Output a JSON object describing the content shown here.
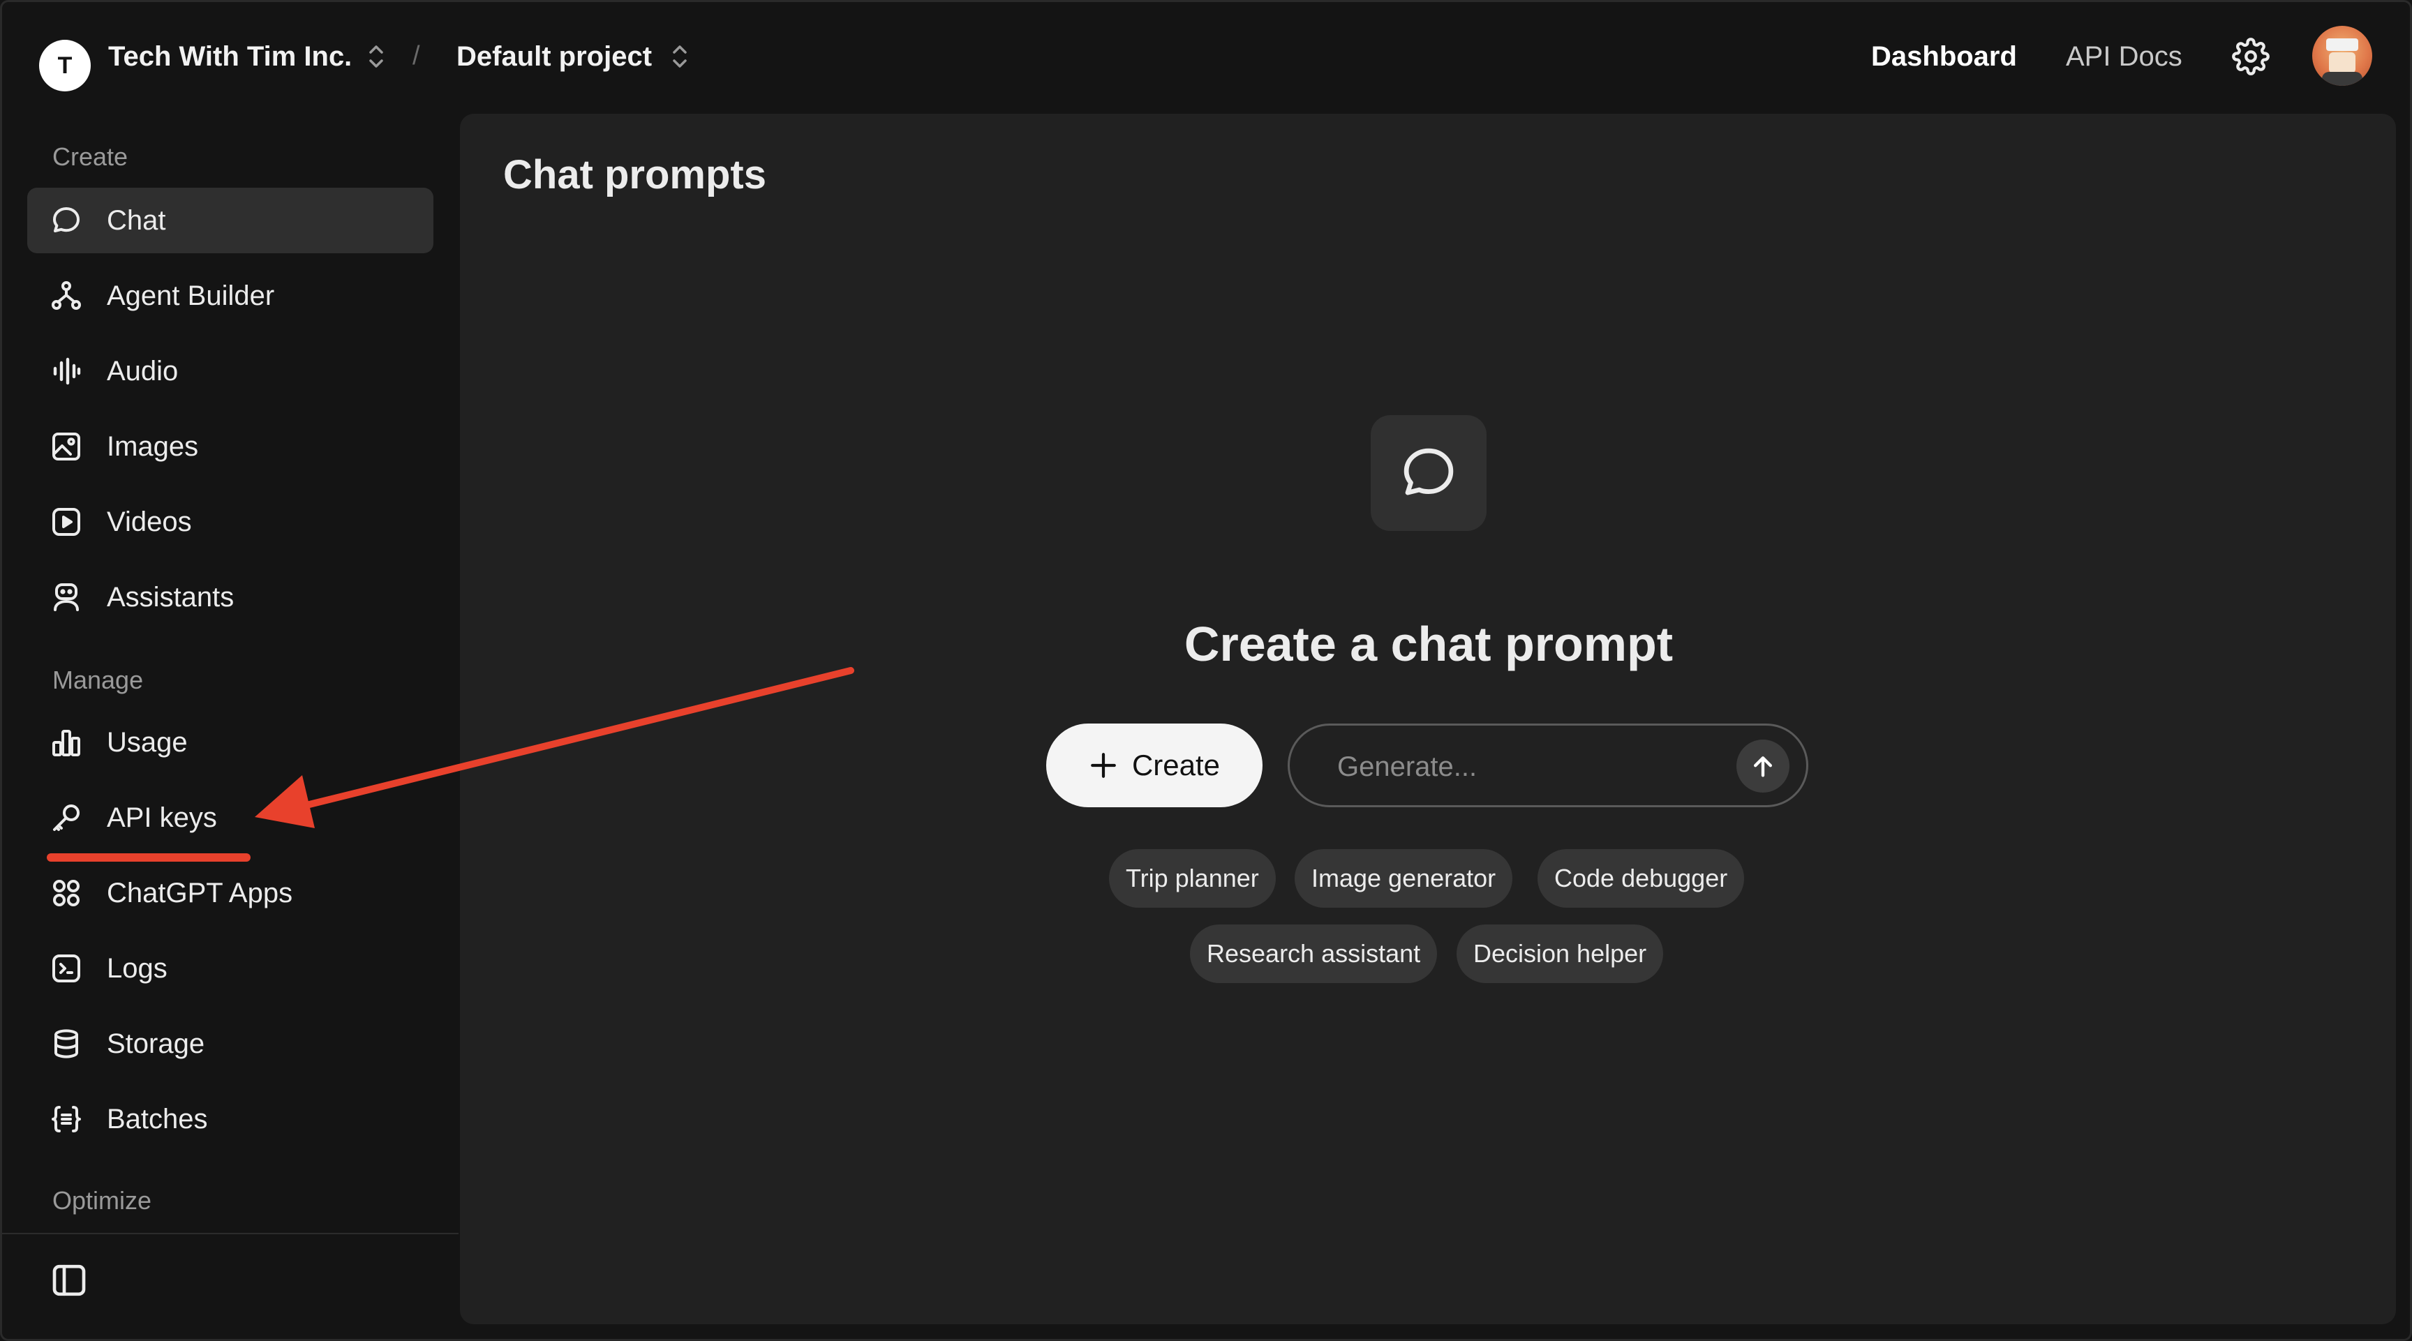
{
  "header": {
    "org_initial": "T",
    "org_name": "Tech With Tim Inc.",
    "separator": "/",
    "project_name": "Default project",
    "nav_dashboard": "Dashboard",
    "nav_api_docs": "API Docs"
  },
  "sidebar": {
    "sections": {
      "create": "Create",
      "manage": "Manage",
      "optimize": "Optimize"
    },
    "items": [
      {
        "label": "Chat",
        "icon": "chat-bubble-icon",
        "active": true
      },
      {
        "label": "Agent Builder",
        "icon": "agent-builder-icon"
      },
      {
        "label": "Audio",
        "icon": "audio-waveform-icon"
      },
      {
        "label": "Images",
        "icon": "image-icon"
      },
      {
        "label": "Videos",
        "icon": "video-play-icon"
      },
      {
        "label": "Assistants",
        "icon": "robot-icon"
      },
      {
        "label": "Usage",
        "icon": "bar-chart-icon"
      },
      {
        "label": "API keys",
        "icon": "key-icon"
      },
      {
        "label": "ChatGPT Apps",
        "icon": "apps-icon"
      },
      {
        "label": "Logs",
        "icon": "terminal-icon"
      },
      {
        "label": "Storage",
        "icon": "database-icon"
      },
      {
        "label": "Batches",
        "icon": "batch-braces-icon"
      }
    ]
  },
  "main": {
    "title": "Chat prompts",
    "empty_state_title": "Create a chat prompt",
    "create_label": "Create",
    "generate_placeholder": "Generate...",
    "generate_value": "",
    "suggestions": [
      "Trip planner",
      "Image generator",
      "Code debugger",
      "Research assistant",
      "Decision helper"
    ]
  },
  "colors": {
    "background": "#141414",
    "panel": "#212121",
    "active_item": "#2f2f2f",
    "chip": "#363636",
    "annotation_red": "#e8412c"
  }
}
